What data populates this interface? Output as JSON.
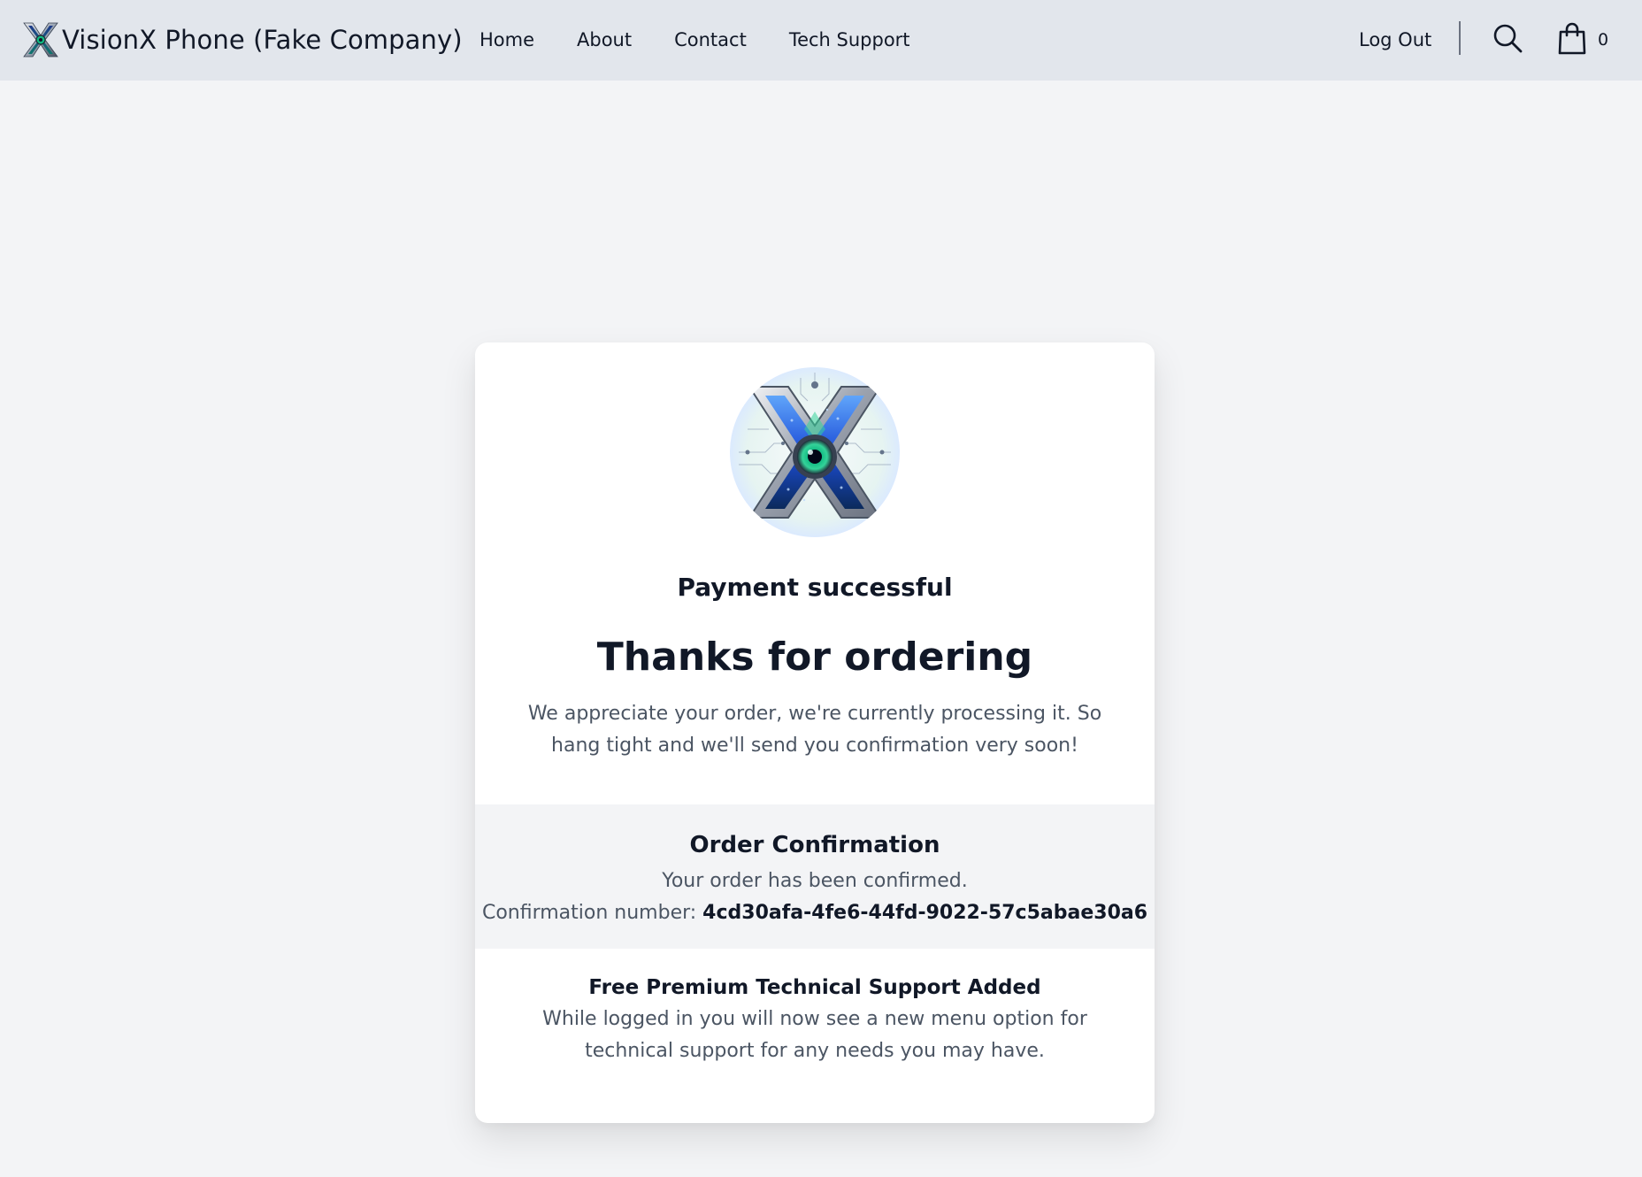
{
  "header": {
    "brand_name": "VisionX Phone (Fake Company)",
    "logo_icon": "visionx-x-logo-icon",
    "nav": [
      {
        "label": "Home"
      },
      {
        "label": "About"
      },
      {
        "label": "Contact"
      },
      {
        "label": "Tech Support"
      }
    ],
    "logout_label": "Log Out",
    "search_icon": "search-icon",
    "cart_icon": "shopping-bag-icon",
    "cart_count": "0"
  },
  "card": {
    "logo_icon": "visionx-x-logo-icon",
    "status": "Payment successful",
    "heading": "Thanks for ordering",
    "message": "We appreciate your order, we're currently processing it. So hang tight and we'll send you confirmation very soon!",
    "confirmation": {
      "title": "Order Confirmation",
      "text": "Your order has been confirmed.",
      "number_label": "Confirmation number:",
      "number": "4cd30afa-4fe6-44fd-9022-57c5abae30a6"
    },
    "support": {
      "title": "Free Premium Technical Support Added",
      "text": "While logged in you will now see a new menu option for technical support for any needs you may have."
    }
  },
  "colors": {
    "header_bg": "#e2e6ec",
    "page_bg": "#f3f4f6",
    "card_bg": "#ffffff",
    "confirm_bg": "#f3f4f6",
    "text_dark": "#111827",
    "text_muted": "#4b5563"
  }
}
